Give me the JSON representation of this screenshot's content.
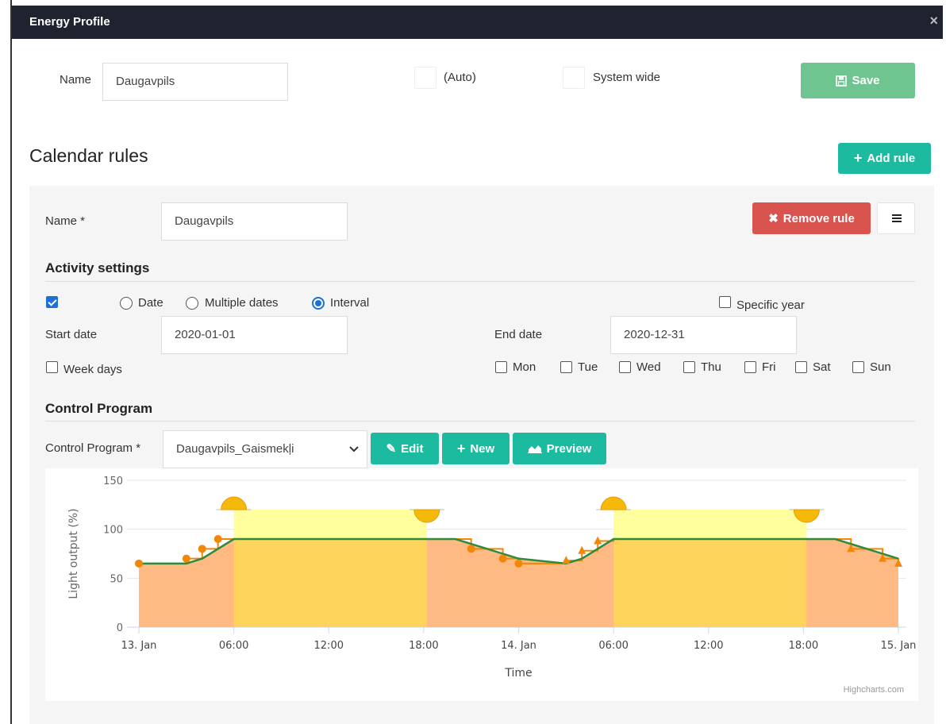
{
  "dialog": {
    "title": "Energy Profile",
    "close": "×"
  },
  "header": {
    "name_label": "Name",
    "name_value": "Daugavpils",
    "auto_label": "(Auto)",
    "system_wide_label": "System wide",
    "save_label": "Save"
  },
  "calendar": {
    "title": "Calendar rules",
    "add_rule_label": "Add rule"
  },
  "rule": {
    "name_label": "Name *",
    "name_value": "Daugavpils",
    "remove_label": "Remove rule",
    "activity_title": "Activity settings",
    "active_checked": true,
    "modes": [
      "Date",
      "Multiple dates",
      "Interval"
    ],
    "selected_mode": "Interval",
    "specific_year_label": "Specific year",
    "start_label": "Start date",
    "start_value": "2020-01-01",
    "end_label": "End date",
    "end_value": "2020-12-31",
    "week_days_label": "Week days",
    "days": [
      "Mon",
      "Tue",
      "Wed",
      "Thu",
      "Fri",
      "Sat",
      "Sun"
    ],
    "program_title": "Control Program",
    "program_label": "Control Program *",
    "program_value": "Daugavpils_Gaismekļi",
    "edit_label": "Edit",
    "new_label": "New",
    "preview_label": "Preview"
  },
  "colors": {
    "save": "#6fc58f",
    "teal": "#1cbb9f",
    "remove": "#d9534f",
    "night_fill": "#ffb982",
    "day_fill": "#ffd45c",
    "day_band": "#ffff9e",
    "line": "#2e8b3e",
    "markers": "#f28705"
  },
  "chart_data": {
    "type": "area",
    "xlabel": "Time",
    "ylabel": "Light output (%)",
    "ylim": [
      0,
      150
    ],
    "yticks": [
      0,
      50,
      100,
      150
    ],
    "xticks": [
      "13. Jan",
      "06:00",
      "12:00",
      "18:00",
      "14. Jan",
      "06:00",
      "12:00",
      "18:00",
      "15. Jan"
    ],
    "credit": "Highcharts.com",
    "x_range_hours": [
      0,
      48
    ],
    "series": [
      {
        "name": "Light output",
        "x_hours": [
          0,
          3,
          4,
          6,
          18,
          20,
          22,
          24,
          27,
          28,
          30,
          42,
          44,
          46,
          48
        ],
        "values": [
          65,
          65,
          70,
          90,
          90,
          90,
          80,
          70,
          65,
          70,
          90,
          90,
          90,
          80,
          70
        ]
      }
    ],
    "day_periods_hours": [
      [
        6,
        18.2
      ],
      [
        30,
        42.2
      ]
    ],
    "markers_circle": [
      [
        0,
        65
      ],
      [
        3,
        70
      ],
      [
        4,
        80
      ],
      [
        5,
        90
      ],
      [
        21,
        80
      ],
      [
        23,
        70
      ],
      [
        24,
        65
      ]
    ],
    "markers_triangle": [
      [
        27,
        68
      ],
      [
        28,
        78
      ],
      [
        29,
        88
      ],
      [
        45,
        80
      ],
      [
        47,
        70
      ],
      [
        48,
        65
      ]
    ]
  }
}
